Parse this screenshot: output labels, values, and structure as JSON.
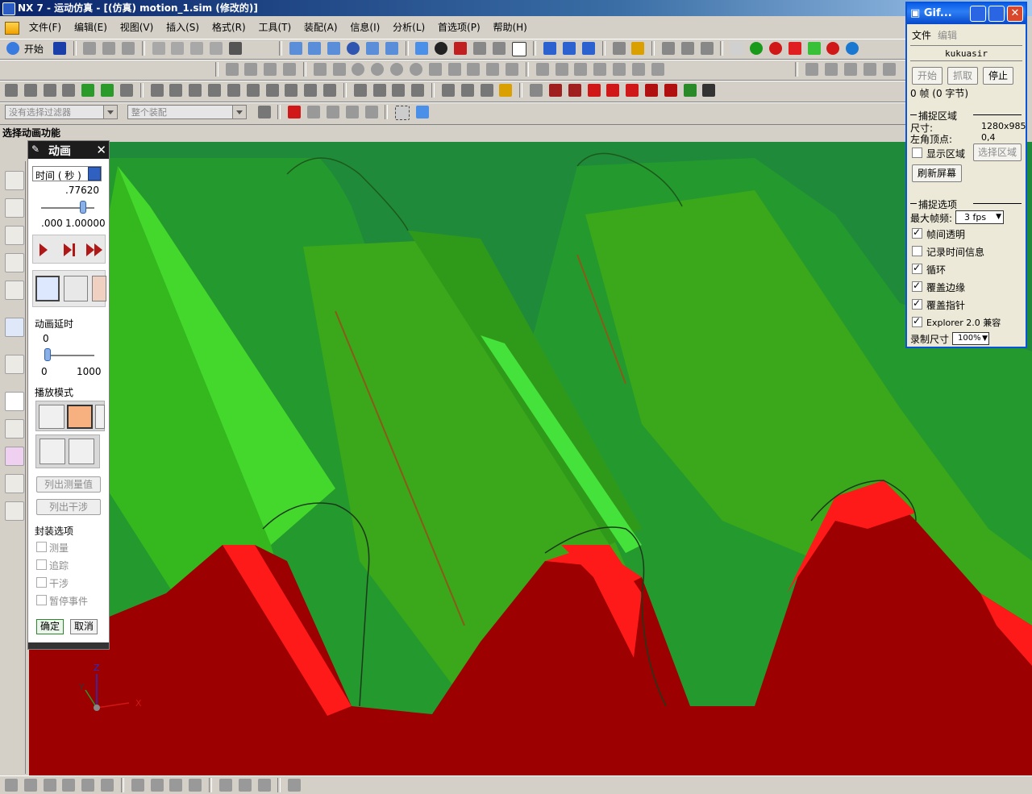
{
  "window": {
    "title": "NX 7 - 运动仿真 - [(仿真) motion_1.sim (修改的)]"
  },
  "menu": [
    "文件(F)",
    "编辑(E)",
    "视图(V)",
    "插入(S)",
    "格式(R)",
    "工具(T)",
    "装配(A)",
    "信息(I)",
    "分析(L)",
    "首选项(P)",
    "帮助(H)"
  ],
  "toolbar": {
    "start_label": "开始",
    "filter_combo": "没有选择过滤器",
    "assembly_combo": "整个装配"
  },
  "status": {
    "prompt": "选择动画功能"
  },
  "anim": {
    "title": "动画",
    "time_mode": "时间 ( 秒 )",
    "time_value": ".77620",
    "time_fraction": 0.776,
    "time_min": ".000",
    "time_max": "1.00000",
    "delay_label": "动画延时",
    "delay_value": "0",
    "delay_min": "0",
    "delay_max": "1000",
    "delay_fraction": 0.0,
    "play_mode_label": "播放模式",
    "list_measure_label": "列出测量值",
    "list_interference_label": "列出干涉",
    "package_label": "封装选项",
    "opt_measure": "测量",
    "opt_trace": "追踪",
    "opt_interfere": "干涉",
    "opt_pause": "暂停事件",
    "ok_label": "确定",
    "cancel_label": "取消"
  },
  "gif": {
    "title": "Gif...",
    "menu_file": "文件",
    "menu_edit": "编辑",
    "name": "kukuasir",
    "start": "开始",
    "capture": "抓取",
    "stop": "停止",
    "frames": "0 帧 (0 字节)",
    "capture_area": "捕捉区域",
    "size_label": "尺寸:",
    "size_value": "1280x985",
    "corner_label": "左角顶点:",
    "corner_value": "0,4",
    "show_area": "显示区域",
    "select_area": "选择区域",
    "refresh": "刷新屏幕",
    "capture_options": "捕捉选项",
    "max_fps_label": "最大帧频:",
    "max_fps_value": "3 fps",
    "opt_transparent": "帧间透明",
    "opt_time": "记录时间信息",
    "opt_loop": "循环",
    "opt_border": "覆盖边缘",
    "opt_pointer": "覆盖指针",
    "opt_explorer": "Explorer 2.0 兼容",
    "record_size_label": "录制尺寸",
    "record_size_value": "100%"
  },
  "axes": {
    "x": "X",
    "y": "Y",
    "z": "Z"
  },
  "colors": {
    "gear_green": "#2e9a2e",
    "gear_dark_green": "#1f7a1f",
    "highlight_green": "#3cd43c",
    "rack_red": "#9c0000",
    "rack_bright": "#ff1a1a"
  }
}
